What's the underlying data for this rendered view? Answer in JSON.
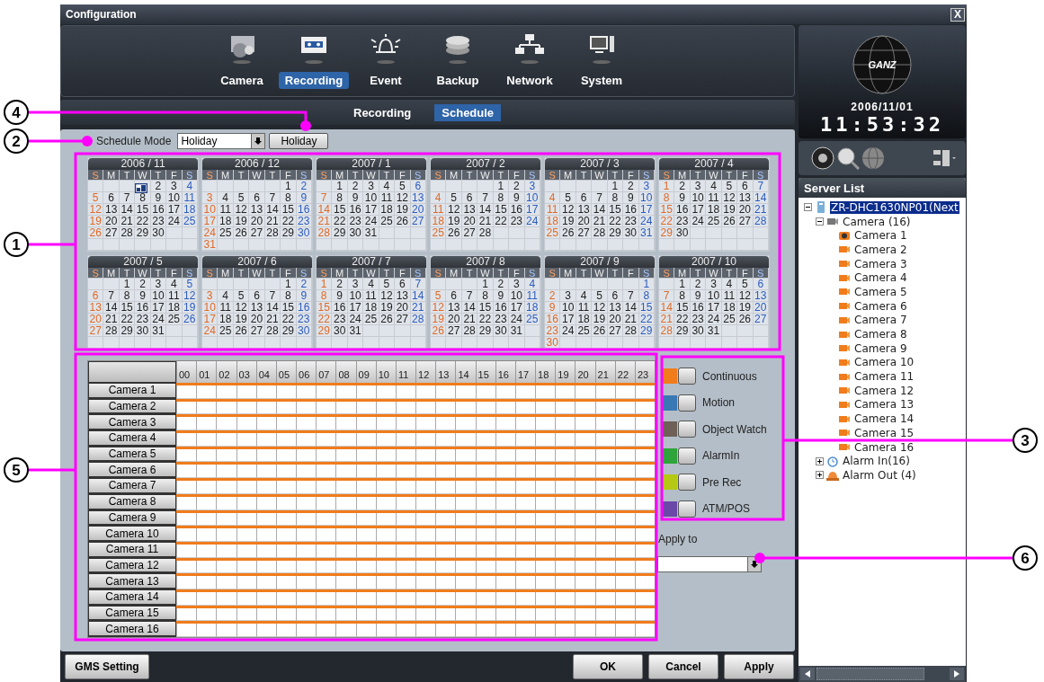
{
  "window": {
    "title": "Configuration",
    "close": "X"
  },
  "nav": [
    {
      "label": "Camera",
      "kind": "camera",
      "selected": false
    },
    {
      "label": "Recording",
      "kind": "recording",
      "selected": true
    },
    {
      "label": "Event",
      "kind": "event",
      "selected": false
    },
    {
      "label": "Backup",
      "kind": "backup",
      "selected": false
    },
    {
      "label": "Network",
      "kind": "network",
      "selected": false
    },
    {
      "label": "System",
      "kind": "system",
      "selected": false
    }
  ],
  "subtabs": [
    {
      "label": "Recording",
      "selected": false
    },
    {
      "label": "Schedule",
      "selected": true
    }
  ],
  "schedule_mode": {
    "label": "Schedule Mode",
    "value": "Holiday",
    "button": "Holiday"
  },
  "calendar": [
    {
      "title": "2006 / 11",
      "weekdays": [
        "S",
        "M",
        "T",
        "W",
        "T",
        "F",
        "S"
      ],
      "weeks": [
        {
          "kind": "lead",
          "days": [
            {
              "today": true
            },
            "2",
            "3",
            "4"
          ]
        },
        {
          "kind": "week",
          "days": [
            "5",
            "6",
            "7",
            "8",
            "9",
            "10",
            "11"
          ]
        },
        {
          "kind": "week",
          "days": [
            "12",
            "13",
            "14",
            "15",
            "16",
            "17",
            "18"
          ]
        },
        {
          "kind": "week",
          "days": [
            "19",
            "20",
            "21",
            "22",
            "23",
            "24",
            "25"
          ]
        },
        {
          "kind": "week",
          "days": [
            "26",
            "27",
            "28",
            "29",
            "30"
          ]
        }
      ]
    },
    {
      "title": "2006 / 12",
      "weekdays": [
        "S",
        "M",
        "T",
        "W",
        "T",
        "F",
        "S"
      ],
      "weeks": [
        {
          "kind": "lead",
          "days": [
            "1",
            "2"
          ]
        },
        {
          "kind": "week",
          "days": [
            "3",
            "4",
            "5",
            "6",
            "7",
            "8",
            "9"
          ]
        },
        {
          "kind": "week",
          "days": [
            "10",
            "11",
            "12",
            "13",
            "14",
            "15",
            "16"
          ]
        },
        {
          "kind": "week",
          "days": [
            "17",
            "18",
            "19",
            "20",
            "21",
            "22",
            "23"
          ]
        },
        {
          "kind": "week",
          "days": [
            "24",
            "25",
            "26",
            "27",
            "28",
            "29",
            "30"
          ]
        },
        {
          "kind": "week",
          "days": [
            "31"
          ]
        }
      ]
    },
    {
      "title": "2007 / 1",
      "weekdays": [
        "S",
        "M",
        "T",
        "W",
        "T",
        "F",
        "S"
      ],
      "weeks": [
        {
          "kind": "lead",
          "days": [
            "1",
            "2",
            "3",
            "4",
            "5",
            "6"
          ]
        },
        {
          "kind": "week",
          "days": [
            "7",
            "8",
            "9",
            "10",
            "11",
            "12",
            "13"
          ]
        },
        {
          "kind": "week",
          "days": [
            "14",
            "15",
            "16",
            "17",
            "18",
            "19",
            "20"
          ]
        },
        {
          "kind": "week",
          "days": [
            "21",
            "22",
            "23",
            "24",
            "25",
            "26",
            "27"
          ]
        },
        {
          "kind": "week",
          "days": [
            "28",
            "29",
            "30",
            "31"
          ]
        }
      ]
    },
    {
      "title": "2007 / 2",
      "weekdays": [
        "S",
        "M",
        "T",
        "W",
        "T",
        "F",
        "S"
      ],
      "weeks": [
        {
          "kind": "lead",
          "days": [
            "1",
            "2",
            "3"
          ]
        },
        {
          "kind": "week",
          "days": [
            "4",
            "5",
            "6",
            "7",
            "8",
            "9",
            "10"
          ]
        },
        {
          "kind": "week",
          "days": [
            "11",
            "12",
            "13",
            "14",
            "15",
            "16",
            "17"
          ]
        },
        {
          "kind": "week",
          "days": [
            "18",
            "19",
            "20",
            "21",
            "22",
            "23",
            "24"
          ]
        },
        {
          "kind": "week",
          "days": [
            "25",
            "26",
            "27",
            "28"
          ]
        }
      ]
    },
    {
      "title": "2007 / 3",
      "weekdays": [
        "S",
        "M",
        "T",
        "W",
        "T",
        "F",
        "S"
      ],
      "weeks": [
        {
          "kind": "lead",
          "days": [
            "1",
            "2",
            "3"
          ]
        },
        {
          "kind": "week",
          "days": [
            "4",
            "5",
            "6",
            "7",
            "8",
            "9",
            "10"
          ]
        },
        {
          "kind": "week",
          "days": [
            "11",
            "12",
            "13",
            "14",
            "15",
            "16",
            "17"
          ]
        },
        {
          "kind": "week",
          "days": [
            "18",
            "19",
            "20",
            "21",
            "22",
            "23",
            "24"
          ]
        },
        {
          "kind": "week",
          "days": [
            "25",
            "26",
            "27",
            "28",
            "29",
            "30",
            "31"
          ]
        }
      ]
    },
    {
      "title": "2007 / 4",
      "weekdays": [
        "S",
        "M",
        "T",
        "W",
        "T",
        "F",
        "S"
      ],
      "weeks": [
        {
          "kind": "week",
          "days": [
            "1",
            "2",
            "3",
            "4",
            "5",
            "6",
            "7"
          ]
        },
        {
          "kind": "week",
          "days": [
            "8",
            "9",
            "10",
            "11",
            "12",
            "13",
            "14"
          ]
        },
        {
          "kind": "week",
          "days": [
            "15",
            "16",
            "17",
            "18",
            "19",
            "20",
            "21"
          ]
        },
        {
          "kind": "week",
          "days": [
            "22",
            "23",
            "24",
            "25",
            "26",
            "27",
            "28"
          ]
        },
        {
          "kind": "week",
          "days": [
            "29",
            "30"
          ]
        }
      ]
    },
    {
      "title": "2007 / 5",
      "weekdays": [
        "S",
        "M",
        "T",
        "W",
        "T",
        "F",
        "S"
      ],
      "weeks": [
        {
          "kind": "lead",
          "days": [
            "1",
            "2",
            "3",
            "4",
            "5"
          ]
        },
        {
          "kind": "week",
          "days": [
            "6",
            "7",
            "8",
            "9",
            "10",
            "11",
            "12"
          ]
        },
        {
          "kind": "week",
          "days": [
            "13",
            "14",
            "15",
            "16",
            "17",
            "18",
            "19"
          ]
        },
        {
          "kind": "week",
          "days": [
            "20",
            "21",
            "22",
            "23",
            "24",
            "25",
            "26"
          ]
        },
        {
          "kind": "week",
          "days": [
            "27",
            "28",
            "29",
            "30",
            "31"
          ]
        }
      ]
    },
    {
      "title": "2007 / 6",
      "weekdays": [
        "S",
        "M",
        "T",
        "W",
        "T",
        "F",
        "S"
      ],
      "weeks": [
        {
          "kind": "lead",
          "days": [
            "1",
            "2"
          ]
        },
        {
          "kind": "week",
          "days": [
            "3",
            "4",
            "5",
            "6",
            "7",
            "8",
            "9"
          ]
        },
        {
          "kind": "week",
          "days": [
            "10",
            "11",
            "12",
            "13",
            "14",
            "15",
            "16"
          ]
        },
        {
          "kind": "week",
          "days": [
            "17",
            "18",
            "19",
            "20",
            "21",
            "22",
            "23"
          ]
        },
        {
          "kind": "week",
          "days": [
            "24",
            "25",
            "26",
            "27",
            "28",
            "29",
            "30"
          ]
        }
      ]
    },
    {
      "title": "2007 / 7",
      "weekdays": [
        "S",
        "M",
        "T",
        "W",
        "T",
        "F",
        "S"
      ],
      "weeks": [
        {
          "kind": "week",
          "days": [
            "1",
            "2",
            "3",
            "4",
            "5",
            "6",
            "7"
          ]
        },
        {
          "kind": "week",
          "days": [
            "8",
            "9",
            "10",
            "11",
            "12",
            "13",
            "14"
          ]
        },
        {
          "kind": "week",
          "days": [
            "15",
            "16",
            "17",
            "18",
            "19",
            "20",
            "21"
          ]
        },
        {
          "kind": "week",
          "days": [
            "22",
            "23",
            "24",
            "25",
            "26",
            "27",
            "28"
          ]
        },
        {
          "kind": "week",
          "days": [
            "29",
            "30",
            "31"
          ]
        }
      ]
    },
    {
      "title": "2007 / 8",
      "weekdays": [
        "S",
        "M",
        "T",
        "W",
        "T",
        "F",
        "S"
      ],
      "weeks": [
        {
          "kind": "lead",
          "days": [
            "1",
            "2",
            "3",
            "4"
          ]
        },
        {
          "kind": "week",
          "days": [
            "5",
            "6",
            "7",
            "8",
            "9",
            "10",
            "11"
          ]
        },
        {
          "kind": "week",
          "days": [
            "12",
            "13",
            "14",
            "15",
            "16",
            "17",
            "18"
          ]
        },
        {
          "kind": "week",
          "days": [
            "19",
            "20",
            "21",
            "22",
            "23",
            "24",
            "25"
          ]
        },
        {
          "kind": "week",
          "days": [
            "26",
            "27",
            "28",
            "29",
            "30",
            "31"
          ]
        }
      ]
    },
    {
      "title": "2007 / 9",
      "weekdays": [
        "S",
        "M",
        "T",
        "W",
        "T",
        "F",
        "S"
      ],
      "weeks": [
        {
          "kind": "lead",
          "days": [
            "1"
          ]
        },
        {
          "kind": "week",
          "days": [
            "2",
            "3",
            "4",
            "5",
            "6",
            "7",
            "8"
          ]
        },
        {
          "kind": "week",
          "days": [
            "9",
            "10",
            "11",
            "12",
            "13",
            "14",
            "15"
          ]
        },
        {
          "kind": "week",
          "days": [
            "16",
            "17",
            "18",
            "19",
            "20",
            "21",
            "22"
          ]
        },
        {
          "kind": "week",
          "days": [
            "23",
            "24",
            "25",
            "26",
            "27",
            "28",
            "29"
          ]
        },
        {
          "kind": "week",
          "days": [
            "30"
          ]
        }
      ]
    },
    {
      "title": "2007 / 10",
      "weekdays": [
        "S",
        "M",
        "T",
        "W",
        "T",
        "F",
        "S"
      ],
      "weeks": [
        {
          "kind": "lead",
          "days": [
            "1",
            "2",
            "3",
            "4",
            "5",
            "6"
          ]
        },
        {
          "kind": "week",
          "days": [
            "7",
            "8",
            "9",
            "10",
            "11",
            "12",
            "13"
          ]
        },
        {
          "kind": "week",
          "days": [
            "14",
            "15",
            "16",
            "17",
            "18",
            "19",
            "20"
          ]
        },
        {
          "kind": "week",
          "days": [
            "21",
            "22",
            "23",
            "24",
            "25",
            "26",
            "27"
          ]
        },
        {
          "kind": "week",
          "days": [
            "28",
            "29",
            "30",
            "31"
          ]
        }
      ]
    }
  ],
  "schedule": {
    "hours": [
      "00",
      "01",
      "02",
      "03",
      "04",
      "05",
      "06",
      "07",
      "08",
      "09",
      "10",
      "11",
      "12",
      "13",
      "14",
      "15",
      "16",
      "17",
      "18",
      "19",
      "20",
      "21",
      "22",
      "23"
    ],
    "rows": [
      {
        "label": "Camera 1",
        "color": "#f07c1c"
      },
      {
        "label": "Camera 2",
        "color": "#f07c1c"
      },
      {
        "label": "Camera 3",
        "color": "#f07c1c"
      },
      {
        "label": "Camera 4",
        "color": "#f07c1c"
      },
      {
        "label": "Camera 5",
        "color": "#f07c1c"
      },
      {
        "label": "Camera 6",
        "color": "#f07c1c"
      },
      {
        "label": "Camera 7",
        "color": "#f07c1c"
      },
      {
        "label": "Camera 8",
        "color": "#f07c1c"
      },
      {
        "label": "Camera 9",
        "color": "#f07c1c"
      },
      {
        "label": "Camera 10",
        "color": "#f07c1c"
      },
      {
        "label": "Camera 11",
        "color": "#f07c1c"
      },
      {
        "label": "Camera 12",
        "color": "#f07c1c"
      },
      {
        "label": "Camera 13",
        "color": "#f07c1c"
      },
      {
        "label": "Camera 14",
        "color": "#f07c1c"
      },
      {
        "label": "Camera 15",
        "color": "#f07c1c"
      },
      {
        "label": "Camera 16",
        "color": "#f07c1c"
      }
    ]
  },
  "legend": [
    {
      "label": "Continuous",
      "color": "#f07c1c"
    },
    {
      "label": "Motion",
      "color": "#3a78b4"
    },
    {
      "label": "Object Watch",
      "color": "#6e6058"
    },
    {
      "label": "AlarmIn",
      "color": "#2fa43a"
    },
    {
      "label": "Pre Rec",
      "color": "#b4c814"
    },
    {
      "label": "ATM/POS",
      "color": "#6a48a8"
    }
  ],
  "apply_to": {
    "label": "Apply to"
  },
  "footer": {
    "left": "GMS Setting",
    "buttons": [
      "OK",
      "Cancel",
      "Apply"
    ]
  },
  "brand": {
    "logo": "GANZ",
    "date": "2006/11/01",
    "time": "11:53:32"
  },
  "server_list": {
    "title": "Server List",
    "tree": [
      {
        "label": "ZR-DHC1630NP01(Next",
        "kind": "server",
        "expanded": true,
        "selected": true,
        "children": [
          {
            "label": "Camera (16)",
            "kind": "group",
            "expanded": true,
            "selected": false,
            "children": [
              {
                "label": "Camera 1",
                "kind": "live",
                "selected": false
              },
              {
                "label": "Camera 2",
                "kind": "camera",
                "selected": false
              },
              {
                "label": "Camera 3",
                "kind": "camera",
                "selected": false
              },
              {
                "label": "Camera 4",
                "kind": "camera",
                "selected": false
              },
              {
                "label": "Camera 5",
                "kind": "camera",
                "selected": false
              },
              {
                "label": "Camera 6",
                "kind": "camera",
                "selected": false
              },
              {
                "label": "Camera 7",
                "kind": "camera",
                "selected": false
              },
              {
                "label": "Camera 8",
                "kind": "camera",
                "selected": false
              },
              {
                "label": "Camera 9",
                "kind": "camera",
                "selected": false
              },
              {
                "label": "Camera 10",
                "kind": "camera",
                "selected": false
              },
              {
                "label": "Camera 11",
                "kind": "camera",
                "selected": false
              },
              {
                "label": "Camera 12",
                "kind": "camera",
                "selected": false
              },
              {
                "label": "Camera 13",
                "kind": "camera",
                "selected": false
              },
              {
                "label": "Camera 14",
                "kind": "camera",
                "selected": false
              },
              {
                "label": "Camera 15",
                "kind": "camera",
                "selected": false
              },
              {
                "label": "Camera 16",
                "kind": "camera",
                "selected": false
              }
            ]
          },
          {
            "label": "Alarm In(16)",
            "kind": "alarm",
            "expanded": false,
            "selected": false
          },
          {
            "label": "Alarm Out (4)",
            "kind": "siren",
            "expanded": false,
            "selected": false
          }
        ]
      }
    ]
  },
  "callouts": [
    "4",
    "2",
    "1",
    "3",
    "5",
    "6"
  ]
}
